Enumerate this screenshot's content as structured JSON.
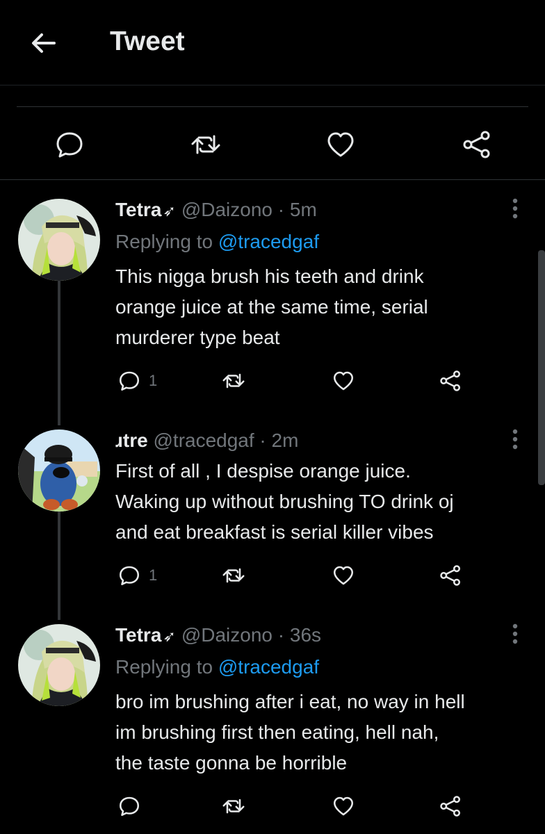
{
  "header": {
    "title": "Tweet",
    "back_icon": "arrow-left-icon"
  },
  "main_actions": [
    "reply-icon",
    "retweet-icon",
    "like-icon",
    "share-icon"
  ],
  "tweets": [
    {
      "name": "Tetra",
      "handle": "@Daizono",
      "time_sep": " · ",
      "time": "5m",
      "replying_prefix": "Replying to ",
      "replying_to": "@tracedgaf",
      "text": "This nigga brush his teeth and drink\norange juice at the same time, serial\nmurderer type beat",
      "reply_count": "1"
    },
    {
      "name": "ɹtre",
      "handle": "@tracedgaf",
      "time_sep": " · ",
      "time": "2m",
      "text": "First of all , I despise orange juice.\nWaking up without brushing TO drink oj\nand eat breakfast is serial killer vibes",
      "reply_count": "1"
    },
    {
      "name": "Tetra",
      "handle": "@Daizono",
      "time_sep": " · ",
      "time": "36s",
      "replying_prefix": "Replying to ",
      "replying_to": "@tracedgaf",
      "text": "bro im brushing after i eat, no way in hell\nim brushing first then eating, hell nah,\nthe taste gonna be horrible",
      "reply_count": ""
    }
  ],
  "colors": {
    "background": "#000000",
    "text": "#e7e9ea",
    "muted": "#71767b",
    "link": "#1d9bf0"
  }
}
